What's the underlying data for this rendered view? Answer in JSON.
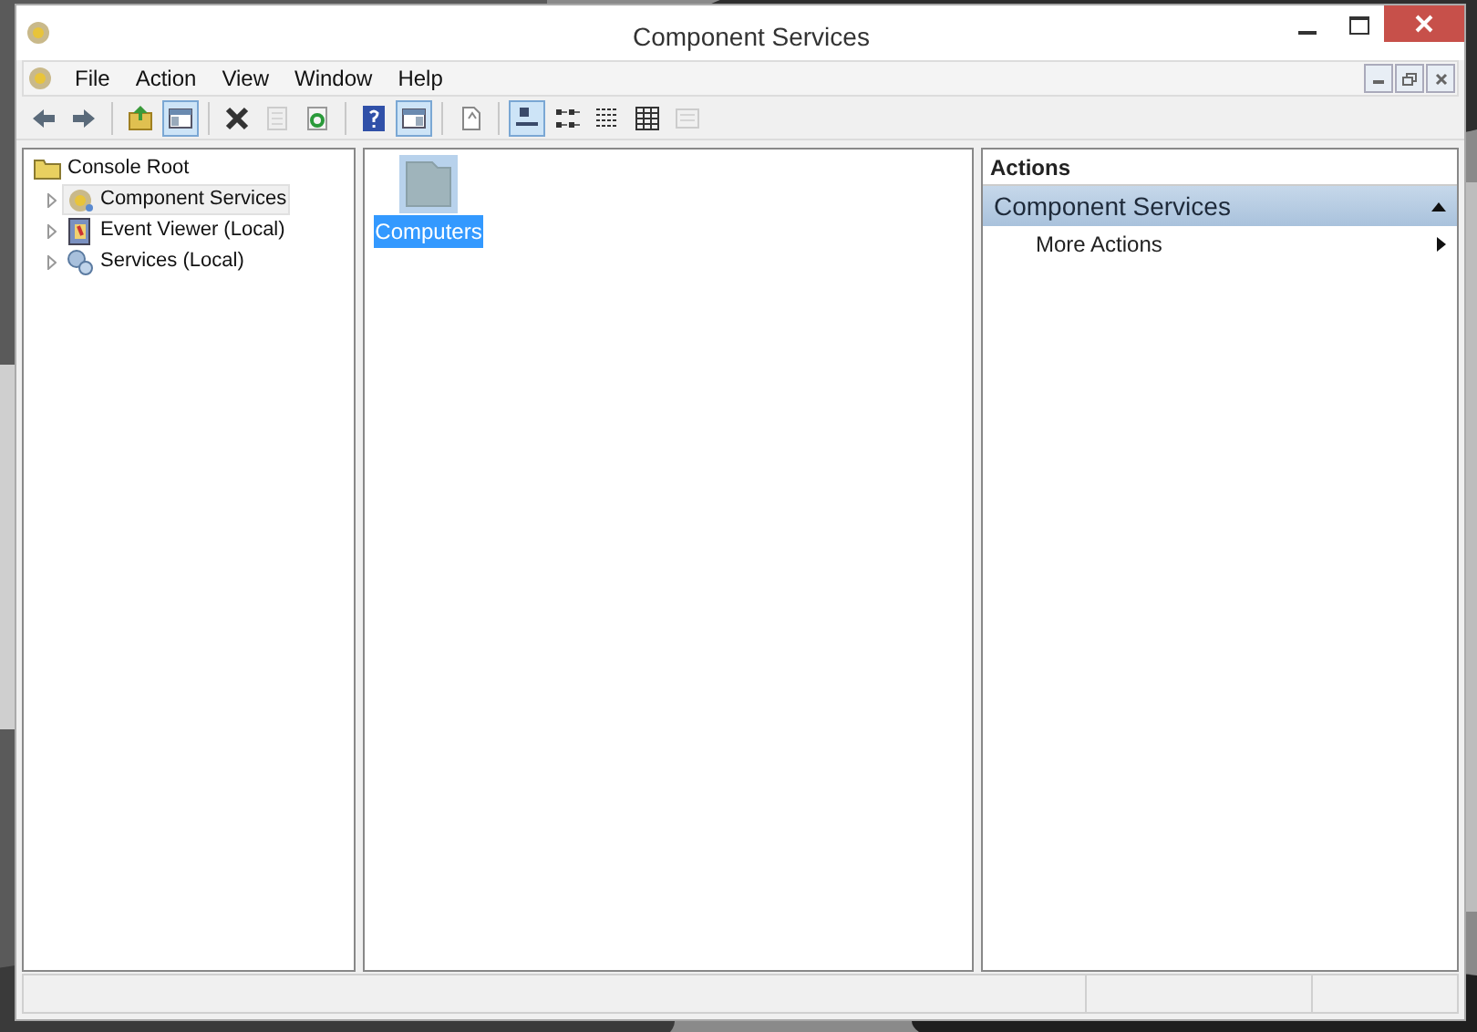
{
  "window": {
    "title": "Component Services"
  },
  "menu": [
    "File",
    "Action",
    "View",
    "Window",
    "Help"
  ],
  "toolbar": [
    {
      "kind": "back",
      "pressed": false,
      "disabled": false
    },
    {
      "kind": "forward",
      "pressed": false,
      "disabled": false
    },
    {
      "kind": "separator"
    },
    {
      "kind": "up",
      "pressed": false,
      "disabled": false
    },
    {
      "kind": "tree",
      "pressed": true,
      "disabled": false
    },
    {
      "kind": "separator"
    },
    {
      "kind": "delete",
      "pressed": false,
      "disabled": false
    },
    {
      "kind": "properties",
      "pressed": false,
      "disabled": true
    },
    {
      "kind": "refresh",
      "pressed": false,
      "disabled": false
    },
    {
      "kind": "separator"
    },
    {
      "kind": "help",
      "pressed": false,
      "disabled": false
    },
    {
      "kind": "actionpane",
      "pressed": true,
      "disabled": false
    },
    {
      "kind": "separator"
    },
    {
      "kind": "export",
      "pressed": false,
      "disabled": false
    },
    {
      "kind": "separator"
    },
    {
      "kind": "largeicons",
      "pressed": true,
      "disabled": false
    },
    {
      "kind": "smallicons",
      "pressed": false,
      "disabled": false
    },
    {
      "kind": "list",
      "pressed": false,
      "disabled": false
    },
    {
      "kind": "details",
      "pressed": false,
      "disabled": false
    },
    {
      "kind": "custom",
      "pressed": false,
      "disabled": true
    }
  ],
  "tree": {
    "label": "Console Root",
    "kind": "folder",
    "children": [
      {
        "label": "Component Services",
        "kind": "component",
        "selected": true,
        "expanded": false
      },
      {
        "label": "Event Viewer (Local)",
        "kind": "eventviewer",
        "selected": false,
        "expanded": false
      },
      {
        "label": "Services (Local)",
        "kind": "services",
        "selected": false,
        "expanded": false
      }
    ]
  },
  "items": [
    {
      "label": "Computers",
      "selected": true
    }
  ],
  "actions": {
    "header": "Actions",
    "section": {
      "title": "Component Services",
      "expanded": true
    },
    "items": [
      {
        "label": "More Actions"
      }
    ]
  }
}
